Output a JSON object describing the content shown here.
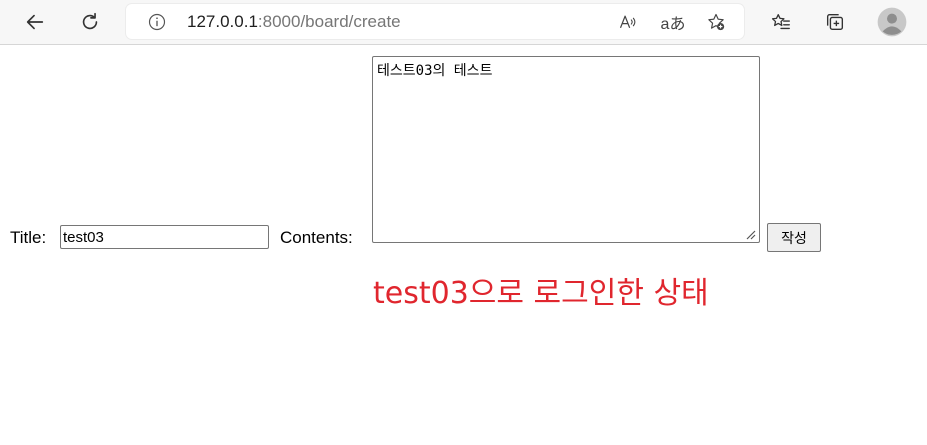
{
  "browser": {
    "url_host": "127.0.0.1",
    "url_path": ":8000/board/create",
    "read_aloud_label": "A",
    "translate_label": "aあ",
    "icons": [
      "back-icon",
      "refresh-icon",
      "info-icon",
      "read-aloud-icon",
      "translate-icon",
      "add-favorite-icon",
      "favorites-icon",
      "collections-icon",
      "profile-icon"
    ]
  },
  "form": {
    "title_label": "Title:",
    "title_value": "test03",
    "contents_label": "Contents:",
    "contents_value": "테스트03의 테스트",
    "submit_label": "작성"
  },
  "annotation": {
    "text": "test03으로 로그인한 상태",
    "color": "#e0262e"
  }
}
